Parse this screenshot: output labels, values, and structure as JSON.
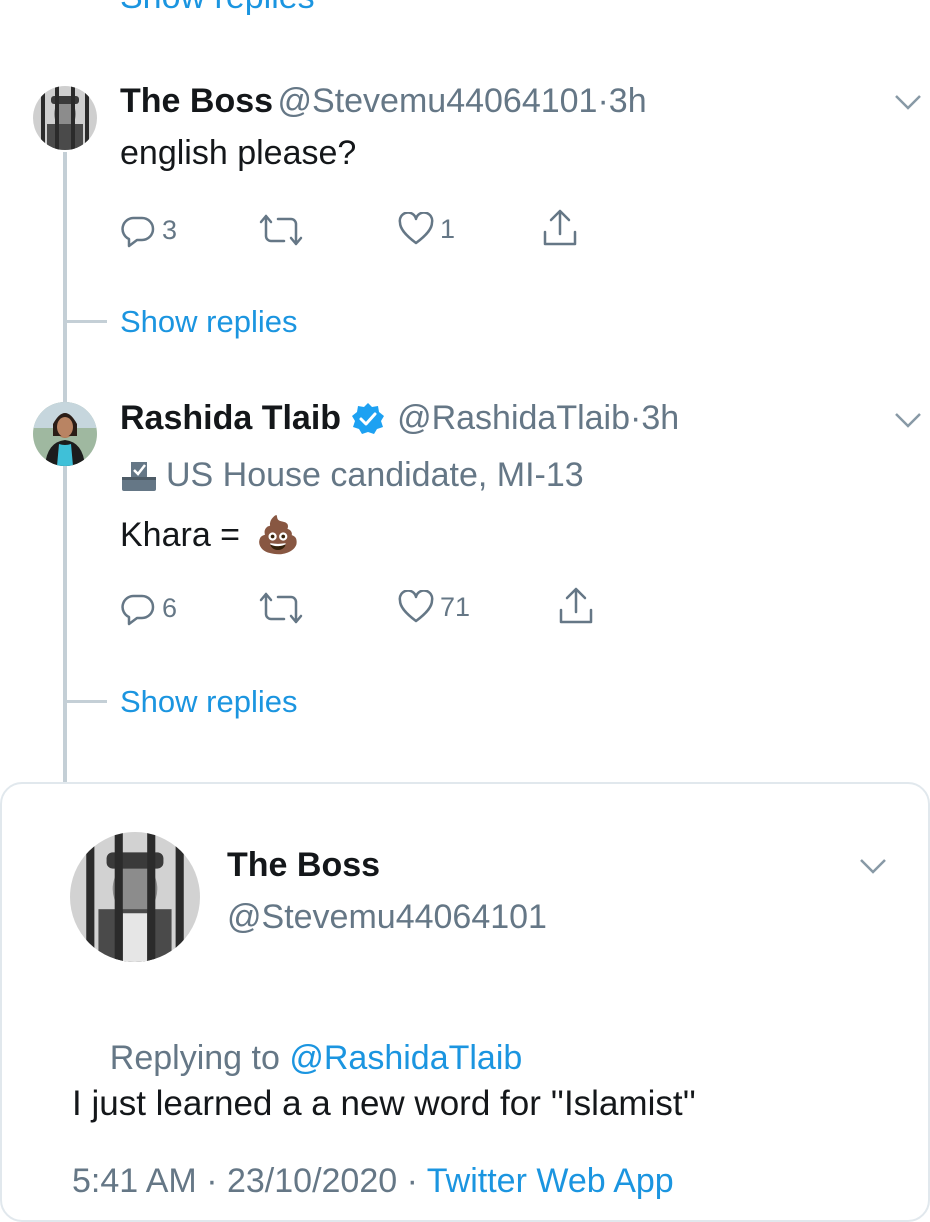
{
  "top_partial": {
    "label": "Show replies"
  },
  "tweet1": {
    "display_name": "The Boss",
    "handle": "@Stevemu44064101",
    "separator": "·",
    "time": "3h",
    "text": "english please?",
    "actions": {
      "reply_count": "3",
      "retweet_count": "",
      "like_count": "1"
    },
    "show_replies": "Show replies",
    "avatar_icon": "jail-bars-avatar-icon"
  },
  "tweet2": {
    "display_name": "Rashida Tlaib",
    "handle": "@RashidaTlaib",
    "separator": "·",
    "time": "3h",
    "label": "US House candidate, MI-13",
    "text": "Khara = ",
    "emoji": "💩",
    "actions": {
      "reply_count": "6",
      "retweet_count": "",
      "like_count": "71"
    },
    "show_replies": "Show replies",
    "verified_color": "#1da1f2"
  },
  "quoted": {
    "display_name": "The Boss",
    "handle": "@Stevemu44064101",
    "replying_prefix": "Replying to ",
    "replying_handle": "@RashidaTlaib",
    "text": "I just learned a a new word for ''Islamist''",
    "time": "5:41 AM",
    "separator1": "·",
    "date": "23/10/2020",
    "separator2": "·",
    "source": "Twitter Web App"
  },
  "colors": {
    "accent": "#1b95e0",
    "muted": "#657786",
    "thread_line": "#c4cfd6",
    "text": "#14171a"
  }
}
